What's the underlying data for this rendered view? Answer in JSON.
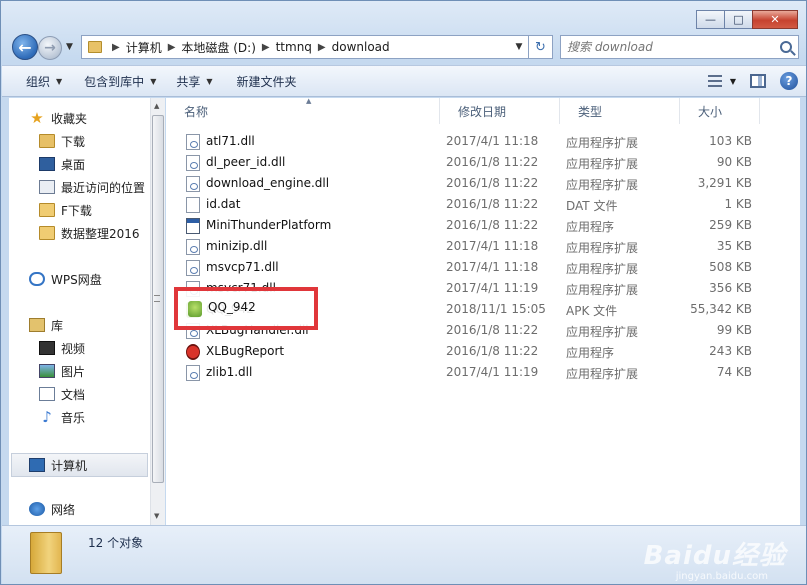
{
  "window": {
    "minimize_glyph": "—",
    "maximize_glyph": "□",
    "close_glyph": "✕"
  },
  "nav": {
    "back_glyph": "←",
    "forward_glyph": "→",
    "breadcrumbs": [
      "计算机",
      "本地磁盘 (D:)",
      "ttmnq",
      "download"
    ],
    "refresh_glyph": "↻"
  },
  "search": {
    "placeholder": "搜索 download"
  },
  "toolbar": {
    "organize": "组织",
    "include_in_library": "包含到库中",
    "share": "共享",
    "new_folder": "新建文件夹",
    "help": "?"
  },
  "sidebar": {
    "favorites": "收藏夹",
    "downloads": "下载",
    "desktop": "桌面",
    "recent": "最近访问的位置",
    "f_downloads": "F下载",
    "data_2016": "数据整理2016",
    "wps_cloud": "WPS网盘",
    "libraries": "库",
    "videos": "视频",
    "pictures": "图片",
    "documents": "文档",
    "music": "音乐",
    "computer": "计算机",
    "network": "网络"
  },
  "columns": {
    "name": "名称",
    "date": "修改日期",
    "type": "类型",
    "size": "大小"
  },
  "files": [
    {
      "name": "atl71.dll",
      "date": "2017/4/1 11:18",
      "type": "应用程序扩展",
      "size": "103 KB",
      "icon": "dll-icon"
    },
    {
      "name": "dl_peer_id.dll",
      "date": "2016/1/8 11:22",
      "type": "应用程序扩展",
      "size": "90 KB",
      "icon": "dll-icon"
    },
    {
      "name": "download_engine.dll",
      "date": "2016/1/8 11:22",
      "type": "应用程序扩展",
      "size": "3,291 KB",
      "icon": "dll-icon"
    },
    {
      "name": "id.dat",
      "date": "2016/1/8 11:22",
      "type": "DAT 文件",
      "size": "1 KB",
      "icon": "dat-icon"
    },
    {
      "name": "MiniThunderPlatform",
      "date": "2016/1/8 11:22",
      "type": "应用程序",
      "size": "259 KB",
      "icon": "app-icon"
    },
    {
      "name": "minizip.dll",
      "date": "2017/4/1 11:18",
      "type": "应用程序扩展",
      "size": "35 KB",
      "icon": "dll-icon"
    },
    {
      "name": "msvcp71.dll",
      "date": "2017/4/1 11:18",
      "type": "应用程序扩展",
      "size": "508 KB",
      "icon": "dll-icon"
    },
    {
      "name": "msvcr71.dll",
      "date": "2017/4/1 11:19",
      "type": "应用程序扩展",
      "size": "356 KB",
      "icon": "dll-icon"
    },
    {
      "name": "QQ_942",
      "date": "2018/11/1 15:05",
      "type": "APK 文件",
      "size": "55,342 KB",
      "icon": "apk-icon"
    },
    {
      "name": "XLBugHandler.dll",
      "date": "2016/1/8 11:22",
      "type": "应用程序扩展",
      "size": "99 KB",
      "icon": "dll-icon"
    },
    {
      "name": "XLBugReport",
      "date": "2016/1/8 11:22",
      "type": "应用程序",
      "size": "243 KB",
      "icon": "bug-icon"
    },
    {
      "name": "zlib1.dll",
      "date": "2017/4/1 11:19",
      "type": "应用程序扩展",
      "size": "74 KB",
      "icon": "dll-icon"
    }
  ],
  "highlight": {
    "label": "QQ_942"
  },
  "status": {
    "count": "12 个对象"
  },
  "watermark": {
    "brand": "Baidu经验",
    "url": "jingyan.baidu.com"
  },
  "colors": {
    "highlight_border": "#e0363a",
    "accent": "#2e6bb8"
  }
}
